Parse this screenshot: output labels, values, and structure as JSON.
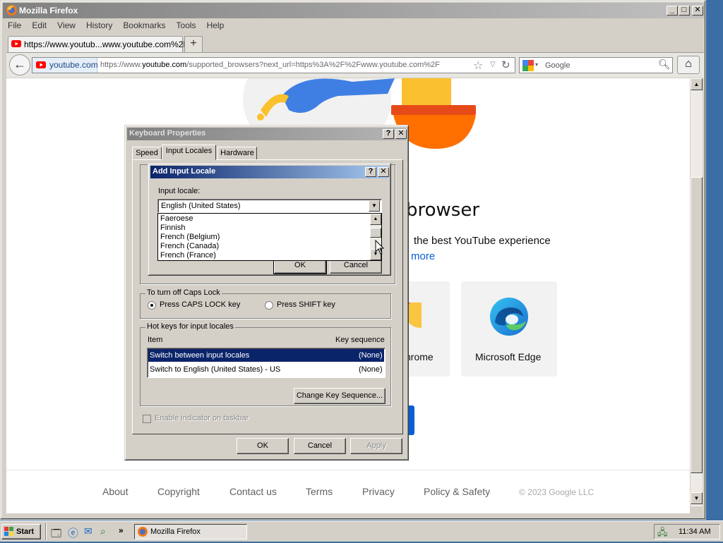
{
  "window": {
    "title": "Mozilla Firefox",
    "menu": [
      "File",
      "Edit",
      "View",
      "History",
      "Bookmarks",
      "Tools",
      "Help"
    ],
    "tab_title": "https://www.youtub...www.youtube.com%2F",
    "new_tab": "+",
    "site_identity": "youtube.com",
    "url_prefix": "https://www.",
    "url_host": "youtube.com",
    "url_rest": "/supported_browsers?next_url=https%3A%2F%2Fwww.youtube.com%2F",
    "search_placeholder": "Google"
  },
  "page": {
    "heading": "browser",
    "subtitle": "the best YouTube experience",
    "more_link": "more",
    "browsers": [
      "hrome",
      "Microsoft Edge"
    ],
    "footer": [
      "About",
      "Copyright",
      "Contact us",
      "Terms",
      "Privacy",
      "Policy & Safety",
      "© 2023 Google LLC"
    ]
  },
  "keyboard_dialog": {
    "title": "Keyboard Properties",
    "tabs": [
      "Speed",
      "Input Locales",
      "Hardware"
    ],
    "caps_group": "To turn off Caps Lock",
    "caps_option1": "Press CAPS LOCK key",
    "caps_option2": "Press SHIFT key",
    "hotkeys_group": "Hot keys for input locales",
    "col_item": "Item",
    "col_key": "Key sequence",
    "rows": [
      {
        "item": "Switch between input locales",
        "key": "(None)"
      },
      {
        "item": "Switch to English (United States) - US",
        "key": "(None)"
      }
    ],
    "change_btn": "Change Key Sequence...",
    "indicator": "Enable indicator on taskbar",
    "ok": "OK",
    "cancel": "Cancel",
    "apply": "Apply"
  },
  "add_locale_dialog": {
    "title": "Add Input Locale",
    "label": "Input locale:",
    "selected": "English (United States)",
    "options": [
      "Faeroese",
      "Finnish",
      "French (Belgium)",
      "French (Canada)",
      "French (France)"
    ],
    "ok": "OK",
    "cancel": "Cancel"
  },
  "taskbar": {
    "start": "Start",
    "task": "Mozilla Firefox",
    "clock": "11:34 AM"
  },
  "colors": {
    "active_title": "#0a246a",
    "inactive_title": "#808080",
    "selection": "#0a246a",
    "youtube_red": "#ff0000",
    "link_blue": "#065fd4"
  }
}
